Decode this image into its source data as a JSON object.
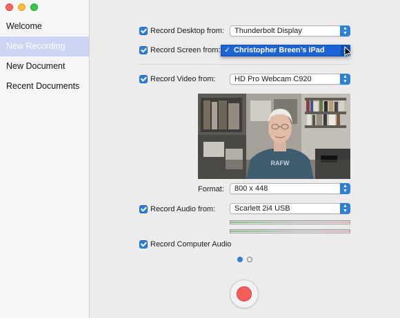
{
  "sidebar": {
    "items": [
      {
        "label": "Welcome",
        "selected": false
      },
      {
        "label": "New Recording",
        "selected": true
      },
      {
        "label": "New Document",
        "selected": false
      },
      {
        "label": "Recent Documents",
        "selected": false
      }
    ]
  },
  "options": {
    "desktop": {
      "label": "Record Desktop from:",
      "checked": true,
      "value": "Thunderbolt Display"
    },
    "screen": {
      "label": "Record Screen from:",
      "checked": true,
      "value": "Christopher Breen’s iPad",
      "menu_open": true
    },
    "video": {
      "label": "Record Video from:",
      "checked": true,
      "value": "HD Pro Webcam C920"
    },
    "format": {
      "label": "Format:",
      "value": "800 x 448"
    },
    "audio": {
      "label": "Record Audio from:",
      "checked": true,
      "value": "Scarlett 2i4 USB"
    },
    "computer_audio": {
      "label": "Record Computer Audio",
      "checked": true
    }
  },
  "camera_preview": {
    "shirt_text": "RAFW"
  },
  "pager": {
    "pages": 2,
    "current": 1
  },
  "colors": {
    "accent": "#2e7fd6",
    "record": "#f55e5c",
    "sidebar_selection": "#cdd5f4"
  },
  "icons": {
    "record_button": "record-icon",
    "popup_arrows": "up-down-chevron-icon",
    "cursor": "mouse-pointer-icon"
  }
}
